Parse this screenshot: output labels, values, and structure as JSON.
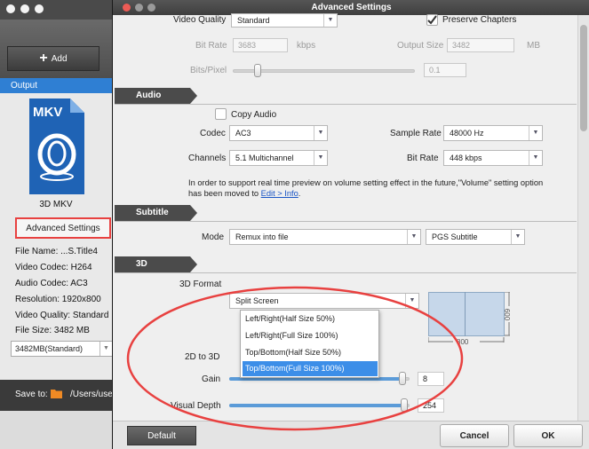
{
  "main_window": {
    "add_label": "Add",
    "output_label": "Output",
    "format_badge": "MKV",
    "format_name": "3D MKV",
    "advanced_settings_label": "Advanced Settings",
    "info": {
      "file_name": "File Name:  ...S.Title4",
      "video_codec": "Video Codec: H264",
      "audio_codec": "Audio Codec: AC3",
      "resolution": "Resolution: 1920x800",
      "video_quality": "Video Quality: Standard",
      "file_size": "File Size: 3482 MB"
    },
    "size_select": "3482MB(Standard)",
    "save_to_label": "Save to:",
    "save_to_path": "/Users/user/"
  },
  "dialog": {
    "title": "Advanced Settings",
    "video": {
      "quality_label": "Video Quality",
      "quality_value": "Standard",
      "preserve_chapters_label": "Preserve Chapters",
      "preserve_chapters_checked": true,
      "bitrate_label": "Bit Rate",
      "bitrate_value": "3683",
      "bitrate_unit": "kbps",
      "output_size_label": "Output Size",
      "output_size_value": "3482",
      "output_size_unit": "MB",
      "bits_per_pixel_label": "Bits/Pixel",
      "bits_per_pixel_value": "0.1"
    },
    "audio": {
      "section_title": "Audio",
      "copy_audio_label": "Copy Audio",
      "codec_label": "Codec",
      "codec_value": "AC3",
      "sample_rate_label": "Sample Rate",
      "sample_rate_value": "48000 Hz",
      "channels_label": "Channels",
      "channels_value": "5.1 Multichannel",
      "bitrate_label": "Bit Rate",
      "bitrate_value": "448 kbps",
      "note_line1": "In order to support real time preview on volume setting effect in the future,\"Volume\" setting option",
      "note_line2_prefix": "has been moved to ",
      "note_link": "Edit > Info",
      "note_line2_suffix": "."
    },
    "subtitle": {
      "section_title": "Subtitle",
      "mode_label": "Mode",
      "mode_value": "Remux into file",
      "track_value": "PGS Subtitle"
    },
    "three_d": {
      "section_title": "3D",
      "format_label": "3D Format",
      "format_value": "Split Screen",
      "options": [
        "Left/Right(Half Size 50%)",
        "Left/Right(Full Size 100%)",
        "Top/Bottom(Half Size 50%)",
        "Top/Bottom(Full Size 100%)"
      ],
      "selected_option_index": 3,
      "preview_width": "800",
      "preview_height": "600",
      "two_d_to_three_d_label": "2D to 3D",
      "gain_label": "Gain",
      "gain_value": "8",
      "gain_level_fraction": 0.98,
      "visual_depth_label": "Visual Depth",
      "visual_depth_value": "254",
      "visual_depth_level_fraction": 0.99
    },
    "buttons": {
      "default": "Default",
      "cancel": "Cancel",
      "ok": "OK"
    }
  },
  "colors": {
    "output_bar": "#2f7fd3",
    "selection": "#3c8ee8",
    "slider_fill": "#5b9bd8",
    "annotation_red": "#e84140"
  }
}
